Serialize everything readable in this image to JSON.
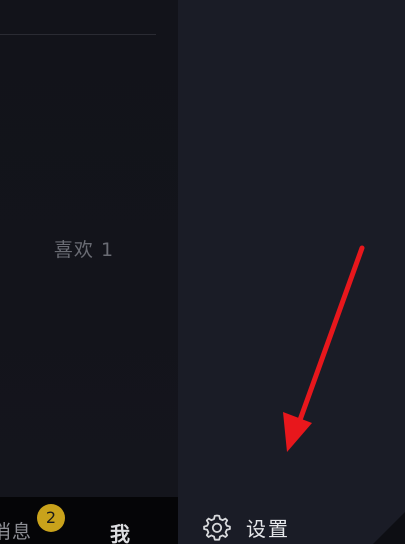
{
  "profile": {
    "likes_label": "喜欢 1"
  },
  "bottom_nav": {
    "messages_label": "消息",
    "messages_badge": "2",
    "me_label": "我"
  },
  "drawer": {
    "settings_label": "设置",
    "settings_icon": "gear-icon"
  },
  "colors": {
    "badge": "#c9a21b",
    "drawer_bg": "#1a1c26",
    "arrow": "#e8171c"
  }
}
